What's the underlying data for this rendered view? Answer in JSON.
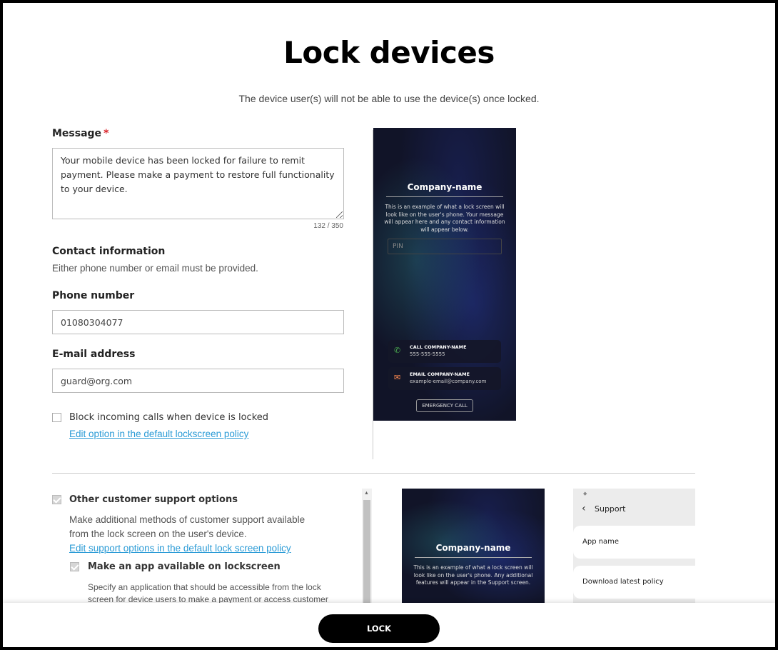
{
  "page": {
    "title": "Lock devices",
    "subtitle": "The device user(s) will not be able to use the device(s) once locked."
  },
  "message": {
    "label": "Message",
    "required_mark": "*",
    "value": "Your mobile device has been locked for failure to remit payment. Please make a payment to restore full functionality to your device.",
    "counter": "132 / 350"
  },
  "contact": {
    "heading": "Contact information",
    "hint": "Either phone number or email must be provided.",
    "phone_label": "Phone number",
    "phone_value": "01080304077",
    "email_label": "E-mail address",
    "email_value": "guard@org.com"
  },
  "block_calls": {
    "label": "Block incoming calls when device is locked",
    "checked": false,
    "link": "Edit option in the default lockscreen policy"
  },
  "support": {
    "label": "Other customer support options",
    "checked": true,
    "description": "Make additional methods of customer support available from the lock screen on the user's device.",
    "link": "Edit support options in the default lock screen policy",
    "app_label": "Make an app available on lockscreen",
    "app_checked": true,
    "app_description": "Specify an application that should be accessible from the lock screen for device users to make a payment or access customer"
  },
  "preview1": {
    "company": "Company-name",
    "text": "This is an example of what a lock screen will look like on the user's phone. Your message will appear here and any contact information will appear below.",
    "pin_placeholder": "PIN",
    "call_title": "CALL COMPANY-NAME",
    "call_number": "555-555-5555",
    "email_title": "EMAIL COMPANY-NAME",
    "email_address": "example-email@company.com",
    "emergency": "EMERGENCY CALL",
    "call_icon": "phone-icon",
    "email_icon": "mail-icon"
  },
  "preview2": {
    "company": "Company-name",
    "text": "This is an example of what a lock screen will look like on the user's phone. Any additional features will appear in the Support screen."
  },
  "support_panel": {
    "title": "Support",
    "items": [
      "App name",
      "Download latest policy"
    ]
  },
  "footer": {
    "lock_label": "LOCK"
  }
}
